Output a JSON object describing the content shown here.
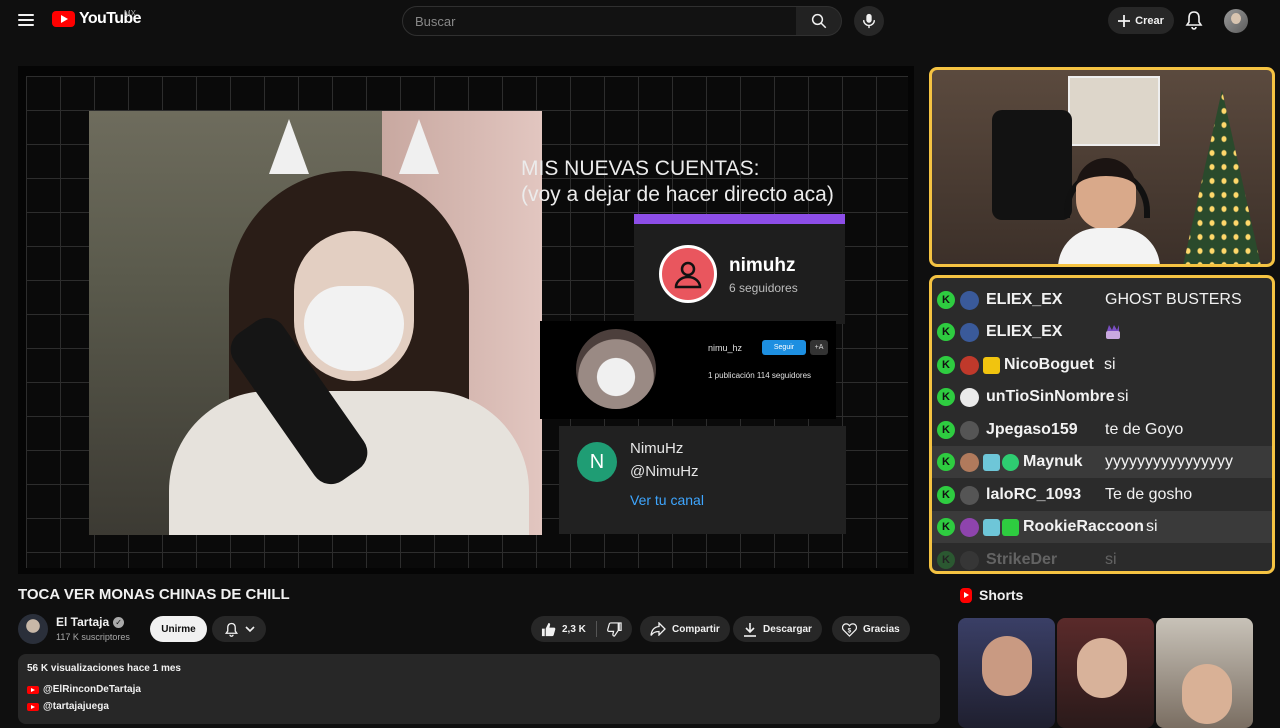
{
  "header": {
    "logo_text": "YouTube",
    "country": "MX",
    "search_placeholder": "Buscar",
    "create_label": "Crear"
  },
  "player": {
    "overlay_title_line1": "MIS NUEVAS CUENTAS:",
    "overlay_title_line2": "(voy a dejar de hacer directo aca)",
    "card1": {
      "name": "nimuhz",
      "followers": "6 seguidores"
    },
    "card2": {
      "handle": "nimu_hz",
      "follow": "Seguir",
      "plus": "+A",
      "stats": "1 publicación      114 seguidores"
    },
    "card3": {
      "avatar_letter": "N",
      "name": "NimuHz",
      "handle": "@NimuHz",
      "link": "Ver tu canal"
    }
  },
  "chat": {
    "rows": [
      {
        "user": "ELIEX_EX",
        "msg": "GHOST BUSTERS"
      },
      {
        "user": "ELIEX_EX",
        "msg": ""
      },
      {
        "user": "NicoBoguet",
        "msg": "si"
      },
      {
        "user": "unTioSinNombre",
        "msg": "si"
      },
      {
        "user": "Jpegaso159",
        "msg": "te de Goyo"
      },
      {
        "user": "Maynuk",
        "msg": "yyyyyyyyyyyyyyyy"
      },
      {
        "user": "laloRC_1093",
        "msg": "Te de gosho"
      },
      {
        "user": "RookieRaccoon",
        "msg": "si"
      },
      {
        "user": "StrikeDer",
        "msg": "si"
      }
    ]
  },
  "video": {
    "title": "TOCA VER MONAS CHINAS DE CHILL",
    "channel": "El Tartaja",
    "subscribers": "117 K suscriptores",
    "join_label": "Unirme",
    "likes": "2,3 K",
    "share_label": "Compartir",
    "download_label": "Descargar",
    "thanks_label": "Gracias"
  },
  "description": {
    "meta": "56 K visualizaciones  hace 1 mes",
    "links": [
      "@ElRinconDeTartaja",
      "@tartajajuega"
    ]
  },
  "shorts": {
    "heading": "Shorts"
  },
  "colors": {
    "accent": "#ff0000",
    "frame": "#f5c342",
    "chat_badge": "#2ecc40",
    "link": "#3ea6ff"
  }
}
